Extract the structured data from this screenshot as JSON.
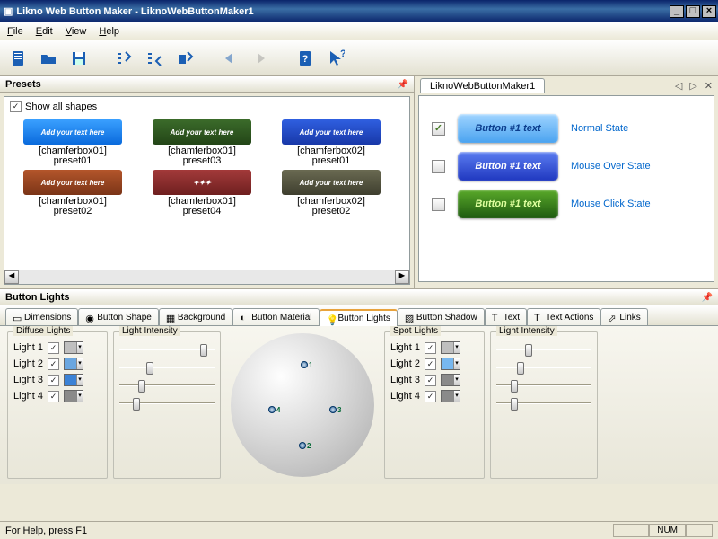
{
  "window": {
    "title": "Likno Web Button Maker - LiknoWebButtonMaker1"
  },
  "menu": {
    "file": "File",
    "edit": "Edit",
    "view": "View",
    "help": "Help"
  },
  "panels": {
    "presets": "Presets",
    "lights": "Button Lights"
  },
  "preview": {
    "tab": "LiknoWebButtonMaker1"
  },
  "showall": "Show all shapes",
  "presetsGrid": [
    {
      "line1": "[chamferbox01]",
      "line2": "preset01",
      "bg": "linear-gradient(#3aa0ff,#0a6adc)",
      "label": "Add your text here"
    },
    {
      "line1": "[chamferbox01]",
      "line2": "preset03",
      "bg": "linear-gradient(#3b6b2a,#234517)",
      "label": "Add your text here"
    },
    {
      "line1": "[chamferbox02]",
      "line2": "preset01",
      "bg": "linear-gradient(#2f5fe0,#1838a8)",
      "label": "Add your text here"
    },
    {
      "line1": "[chamferbox01]",
      "line2": "preset02",
      "bg": "linear-gradient(#b4562b,#7a3417)",
      "label": "Add your text here"
    },
    {
      "line1": "[chamferbox01]",
      "line2": "preset04",
      "bg": "linear-gradient(#a33a3a,#6e1f1f)",
      "label": "✦✦✦"
    },
    {
      "line1": "[chamferbox02]",
      "line2": "preset02",
      "bg": "linear-gradient(#6a6a52,#3e3e2e)",
      "label": "Add your text here"
    }
  ],
  "states": [
    {
      "label": "Button #1 text",
      "state": "Normal State",
      "checked": true,
      "bg": "linear-gradient(#9fd4ff,#4aa3f0)",
      "fg": "#0b3c8c"
    },
    {
      "label": "Button #1 text",
      "state": "Mouse Over State",
      "checked": false,
      "bg": "linear-gradient(#5a7cf0,#2038c0)",
      "fg": "#fff"
    },
    {
      "label": "Button #1 text",
      "state": "Mouse Click State",
      "checked": false,
      "bg": "linear-gradient(#5aaa2a,#1e5a10)",
      "fg": "#dfff9f"
    }
  ],
  "tabs": [
    "Dimensions",
    "Button Shape",
    "Background",
    "Button Material",
    "Button Lights",
    "Button Shadow",
    "Text",
    "Text Actions",
    "Links"
  ],
  "activeTab": 4,
  "diffuse": {
    "title": "Diffuse Lights",
    "intensity": "Light Intensity",
    "rows": [
      {
        "label": "Light  1",
        "on": true,
        "color": "#bfbfbf",
        "pos": 85
      },
      {
        "label": "Light  2",
        "on": true,
        "color": "#6aa6e0",
        "pos": 28
      },
      {
        "label": "Light  3",
        "on": true,
        "color": "#3b82d6",
        "pos": 20
      },
      {
        "label": "Light  4",
        "on": true,
        "color": "#8a8a8a",
        "pos": 14
      }
    ]
  },
  "spot": {
    "title": "Spot Lights",
    "intensity": "Light Intensity",
    "rows": [
      {
        "label": "Light  1",
        "on": true,
        "color": "#bfbfbf",
        "pos": 30
      },
      {
        "label": "Light  2",
        "on": true,
        "color": "#77b7ef",
        "pos": 22
      },
      {
        "label": "Light  3",
        "on": true,
        "color": "#8a8a8a",
        "pos": 15
      },
      {
        "label": "Light  4",
        "on": true,
        "color": "#8a8a8a",
        "pos": 15
      }
    ]
  },
  "status": {
    "help": "For Help, press F1",
    "num": "NUM"
  }
}
